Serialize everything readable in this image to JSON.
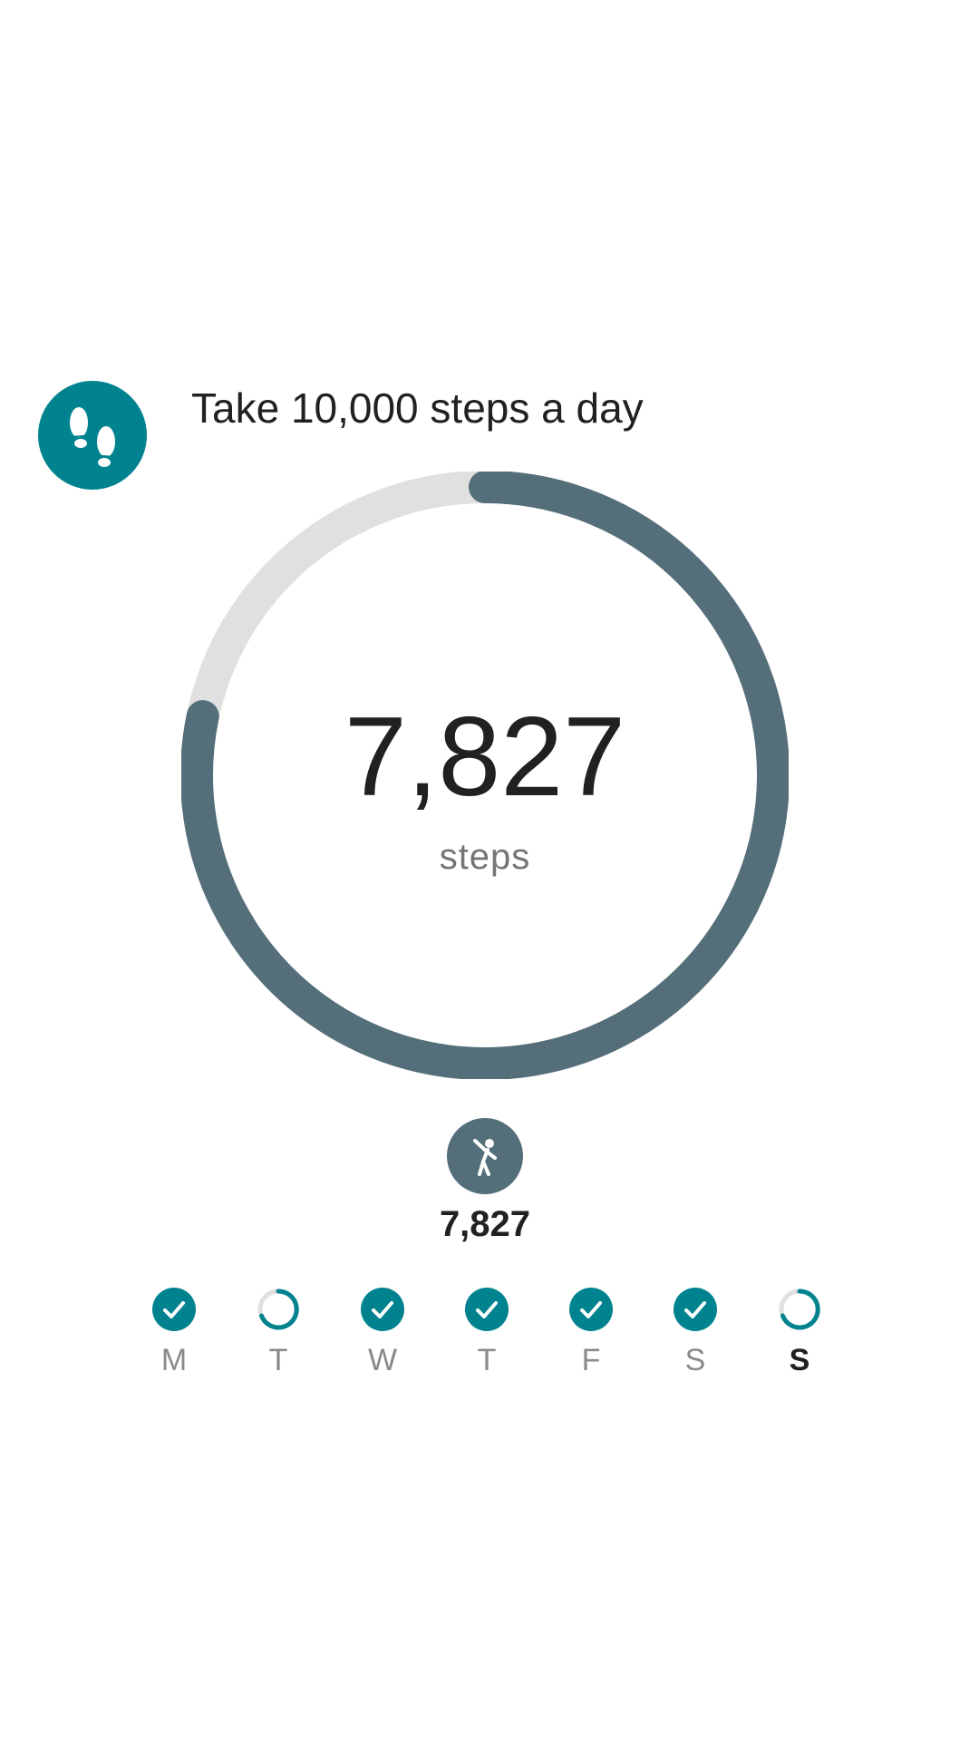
{
  "goal": {
    "title": "Take 10,000 steps a day",
    "icon": "footprints-icon",
    "icon_color": "#00838F"
  },
  "progress": {
    "steps": "7,827",
    "unit": "steps",
    "fraction": 0.7827,
    "progress_color": "#546E7A",
    "track_color": "#E0E0E0"
  },
  "activity": {
    "icon": "person-walking-icon",
    "count": "7,827",
    "badge_color": "#546E7A"
  },
  "week": {
    "complete_color": "#00838F",
    "days": [
      {
        "label": "M",
        "status": "complete"
      },
      {
        "label": "T",
        "status": "partial"
      },
      {
        "label": "W",
        "status": "complete"
      },
      {
        "label": "T",
        "status": "complete"
      },
      {
        "label": "F",
        "status": "complete"
      },
      {
        "label": "S",
        "status": "complete"
      },
      {
        "label": "S",
        "status": "partial",
        "current": true
      }
    ]
  }
}
